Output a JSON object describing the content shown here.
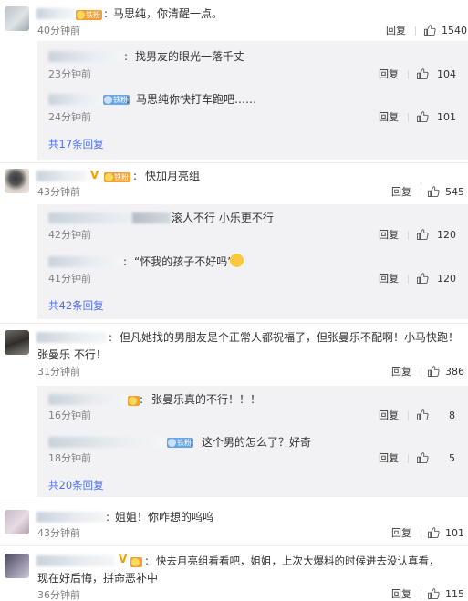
{
  "labels": {
    "reply": "回复",
    "colon": ":",
    "badge_fan": "铁粉"
  },
  "colors": {
    "link": "#4e6ef2",
    "muted": "#808080",
    "sub_bg": "#f2f2f5",
    "badge_gold": "#f6a033",
    "badge_blue": "#68a6e5"
  },
  "comments": [
    {
      "text": "马思纯，你清醒一点。",
      "time": "40分钟前",
      "likes": "1540",
      "replies": [
        {
          "text": "找男友的眼光一落千丈",
          "time": "23分钟前",
          "likes": "104"
        },
        {
          "text": "马思纯你快打车跑吧……",
          "time": "24分钟前",
          "likes": "101"
        }
      ],
      "more": "共17条回复"
    },
    {
      "text": "快加月亮组",
      "time": "43分钟前",
      "likes": "545",
      "replies": [
        {
          "text": "滚人不行 小乐更不行",
          "time": "42分钟前",
          "likes": "120"
        },
        {
          "text": "“怀我的孩子不好吗”",
          "time": "41分钟前",
          "likes": "120"
        }
      ],
      "more": "共42条回复"
    },
    {
      "text_line1": "但凡她找的男朋友是个正常人都祝福了，但张曼乐不配啊！小马快跑！",
      "text_line2": "张曼乐 不行！",
      "time": "31分钟前",
      "likes": "386",
      "replies": [
        {
          "text": "张曼乐真的不行！！！",
          "time": "16分钟前",
          "likes": "8"
        },
        {
          "text": "这个男的怎么了？好奇",
          "time": "18分钟前",
          "likes": "5"
        }
      ],
      "more": "共20条回复"
    },
    {
      "text": "姐姐！你咋想的呜呜",
      "time": "43分钟前",
      "likes": "101"
    },
    {
      "text_line1": "快去月亮组看看吧，姐姐，上次大爆料的时候进去没认真看，",
      "text_line2": "现在好后悔，拼命恶补中",
      "time": "36分钟前",
      "likes": "115"
    }
  ]
}
